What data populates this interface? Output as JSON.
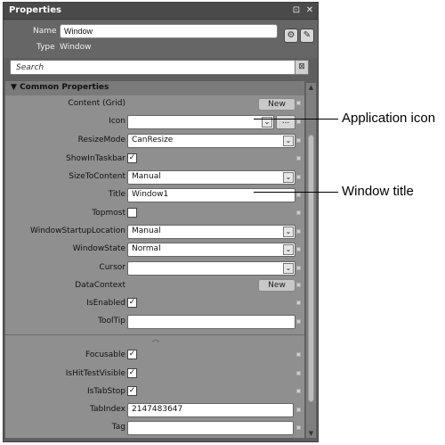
{
  "panel": {
    "title": "Properties",
    "name_label": "Name",
    "name_value": "Window",
    "type_label": "Type",
    "type_value": "Window",
    "search_placeholder": "Search",
    "icons": [
      "pin-icon",
      "close-icon",
      "events-icon",
      "properties-icon",
      "clear-search-icon"
    ]
  },
  "category": {
    "label": "Common Properties"
  },
  "properties": {
    "content": {
      "label": "Content",
      "value": "(Grid)",
      "button": "New"
    },
    "icon": {
      "label": "Icon",
      "value": "",
      "button": "..."
    },
    "resizemode": {
      "label": "ResizeMode",
      "value": "CanResize"
    },
    "showintaskbar": {
      "label": "ShowInTaskbar",
      "checked": true
    },
    "sizetocontent": {
      "label": "SizeToContent",
      "value": "Manual"
    },
    "title": {
      "label": "Title",
      "value": "Window1"
    },
    "topmost": {
      "label": "Topmost",
      "checked": false
    },
    "startuplocation": {
      "label": "WindowStartupLocation",
      "value": "Manual"
    },
    "windowstate": {
      "label": "WindowState",
      "value": "Normal"
    },
    "cursor": {
      "label": "Cursor",
      "value": ""
    },
    "datacontext": {
      "label": "DataContext",
      "button": "New"
    },
    "isenabled": {
      "label": "IsEnabled",
      "checked": true
    },
    "tooltip": {
      "label": "ToolTip",
      "value": ""
    },
    "focusable": {
      "label": "Focusable",
      "checked": true
    },
    "ishittestvisible": {
      "label": "IsHitTestVisible",
      "checked": true
    },
    "istabstop": {
      "label": "IsTabStop",
      "checked": true
    },
    "tabindex": {
      "label": "TabIndex",
      "value": "2147483647"
    },
    "tag": {
      "label": "Tag",
      "value": ""
    }
  },
  "callouts": {
    "application_icon": "Application icon",
    "window_title": "Window title"
  },
  "colors": {
    "panel_bg": "#5f5f5f",
    "grid_bg": "#8f8f8f",
    "category_bg": "#7a7a7a"
  }
}
